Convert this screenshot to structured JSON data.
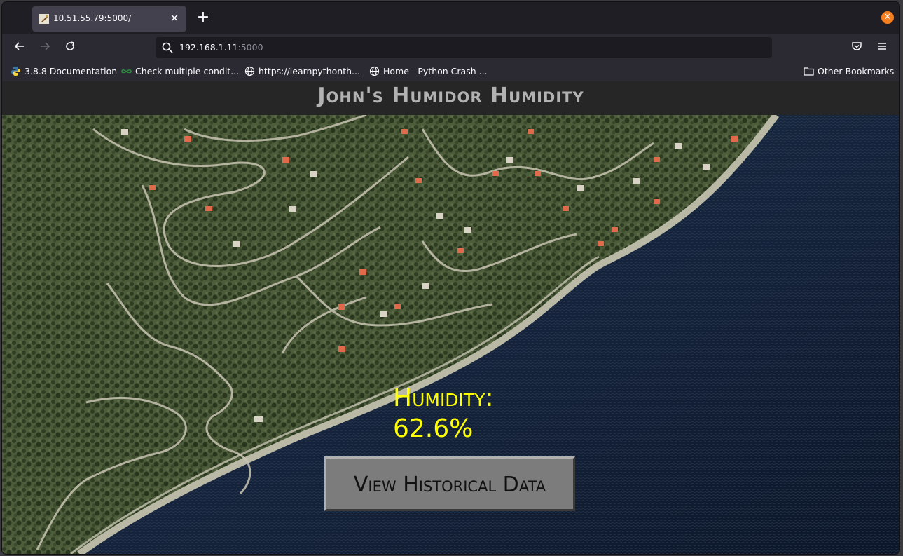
{
  "browser": {
    "tab": {
      "title": "10.51.55.79:5000/"
    },
    "address": {
      "host": "192.168.1.11",
      "port": ":5000"
    },
    "bookmarks": [
      {
        "label": "3.8.8 Documentation",
        "icon": "python-icon"
      },
      {
        "label": "Check multiple condit...",
        "icon": "geeks-icon"
      },
      {
        "label": "https://learnpythonth...",
        "icon": "globe-icon"
      },
      {
        "label": "Home - Python Crash ...",
        "icon": "globe-icon"
      }
    ],
    "other_bookmarks": "Other Bookmarks"
  },
  "page": {
    "title": "John's Humidor Humidity",
    "humidity_label": "Humidity:",
    "humidity_value": "62.6%",
    "button_label": "View Historical Data"
  },
  "colors": {
    "accent": "#ffff00",
    "header_bg": "#262626",
    "button_bg": "#7c7c7c"
  }
}
